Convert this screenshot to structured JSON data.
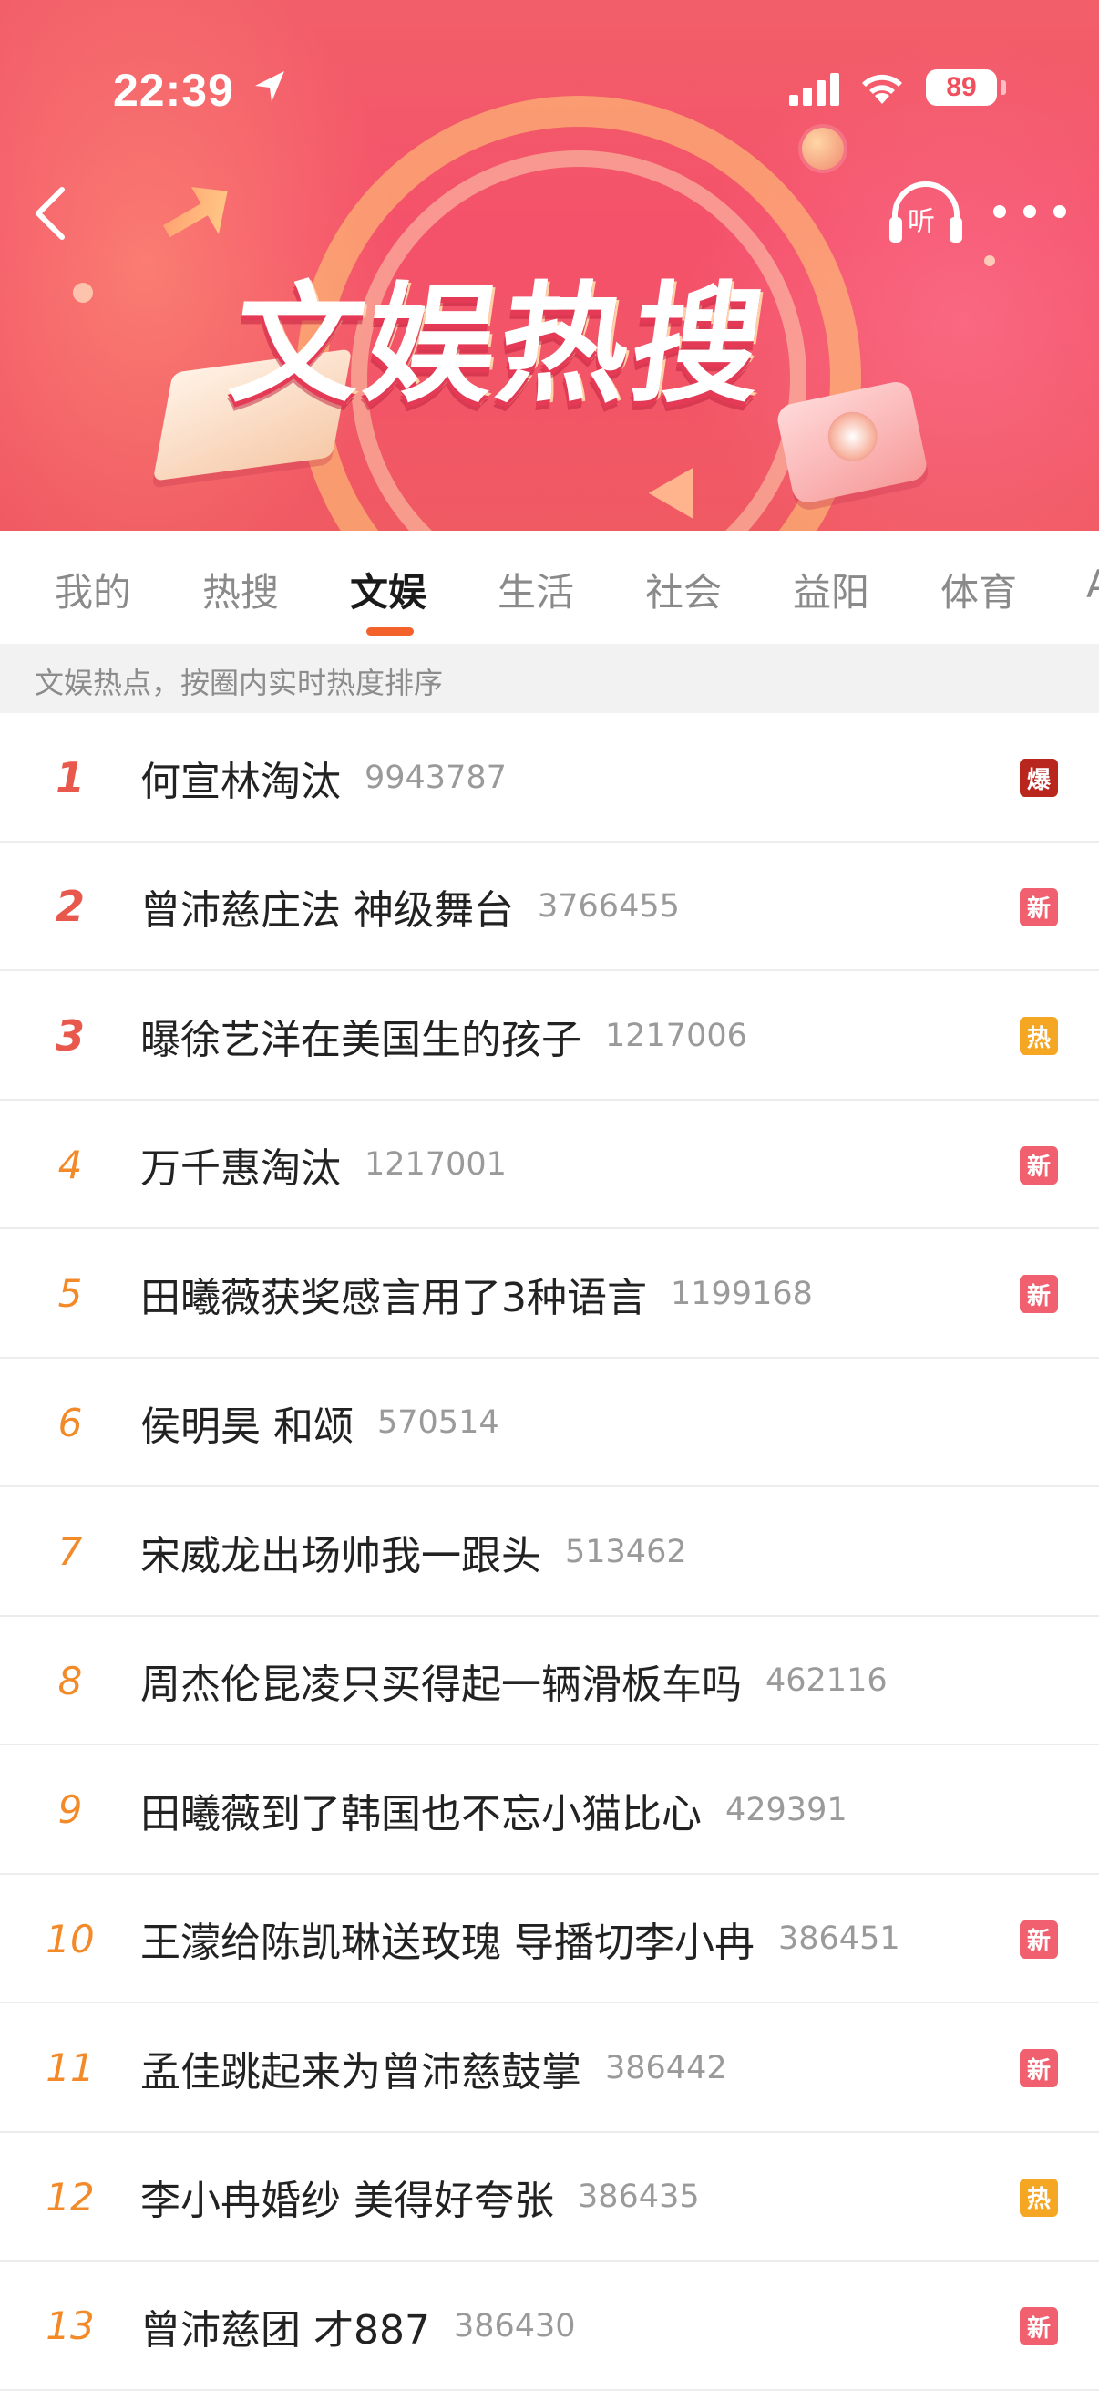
{
  "status_bar": {
    "time": "22:39",
    "battery": "89",
    "location_icon": "location-arrow-icon",
    "signal_icon": "cellular-signal-icon",
    "wifi_icon": "wifi-icon"
  },
  "header": {
    "title": "文娱热搜",
    "listen_label": "听",
    "back_icon": "chevron-left-icon",
    "listen_icon": "headphones-icon",
    "more_icon": "more-dots-icon"
  },
  "tabs": [
    {
      "label": "我的",
      "active": false
    },
    {
      "label": "热搜",
      "active": false
    },
    {
      "label": "文娱",
      "active": true
    },
    {
      "label": "生活",
      "active": false
    },
    {
      "label": "社会",
      "active": false
    },
    {
      "label": "益阳",
      "active": false
    },
    {
      "label": "体育",
      "active": false
    },
    {
      "label": "A",
      "active": false
    }
  ],
  "subtitle": "文娱热点，按圈内实时热度排序",
  "colors": {
    "accent": "#f2622a",
    "rank_top": "#e8584c",
    "rank_other": "#f28a2a",
    "badge_explode": "#b8261e",
    "badge_new": "#f0606e",
    "badge_hot": "#f5a623"
  },
  "list": [
    {
      "rank": "1",
      "title": "何宣林淘汰",
      "count": "9943787",
      "badge": "爆",
      "badge_type": "explode"
    },
    {
      "rank": "2",
      "title": "曾沛慈庄法 神级舞台",
      "count": "3766455",
      "badge": "新",
      "badge_type": "new"
    },
    {
      "rank": "3",
      "title": "曝徐艺洋在美国生的孩子",
      "count": "1217006",
      "badge": "热",
      "badge_type": "hot"
    },
    {
      "rank": "4",
      "title": "万千惠淘汰",
      "count": "1217001",
      "badge": "新",
      "badge_type": "new"
    },
    {
      "rank": "5",
      "title": "田曦薇获奖感言用了3种语言",
      "count": "1199168",
      "badge": "新",
      "badge_type": "new"
    },
    {
      "rank": "6",
      "title": "侯明昊 和颂",
      "count": "570514",
      "badge": "",
      "badge_type": ""
    },
    {
      "rank": "7",
      "title": "宋威龙出场帅我一跟头",
      "count": "513462",
      "badge": "",
      "badge_type": ""
    },
    {
      "rank": "8",
      "title": "周杰伦昆凌只买得起一辆滑板车吗",
      "count": "462116",
      "badge": "",
      "badge_type": ""
    },
    {
      "rank": "9",
      "title": "田曦薇到了韩国也不忘小猫比心",
      "count": "429391",
      "badge": "",
      "badge_type": ""
    },
    {
      "rank": "10",
      "title": "王濛给陈凯琳送玫瑰 导播切李小冉",
      "count": "386451",
      "badge": "新",
      "badge_type": "new"
    },
    {
      "rank": "11",
      "title": "孟佳跳起来为曾沛慈鼓掌",
      "count": "386442",
      "badge": "新",
      "badge_type": "new"
    },
    {
      "rank": "12",
      "title": "李小冉婚纱 美得好夸张",
      "count": "386435",
      "badge": "热",
      "badge_type": "hot"
    },
    {
      "rank": "13",
      "title": "曾沛慈团 才887",
      "count": "386430",
      "badge": "新",
      "badge_type": "new"
    }
  ]
}
